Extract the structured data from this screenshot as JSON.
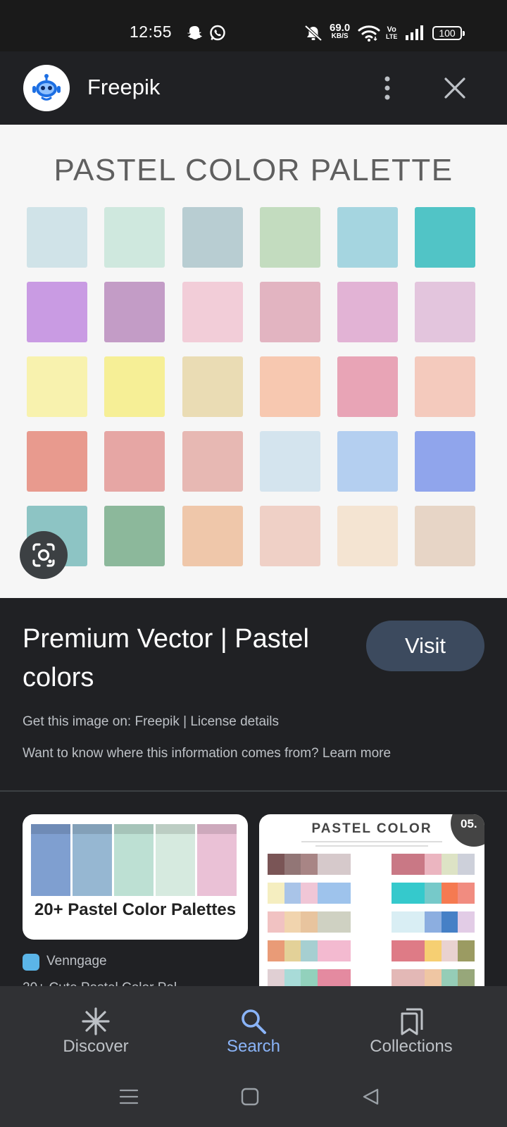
{
  "status_bar": {
    "time": "12:55",
    "net_speed_value": "69.0",
    "net_speed_unit": "KB/S",
    "volte_top": "Vo",
    "volte_bottom": "LTE",
    "battery": "100",
    "icons": [
      "snapchat-icon",
      "whatsapp-icon",
      "mute-icon",
      "wifi-icon",
      "signal-icon",
      "battery-icon"
    ]
  },
  "header": {
    "site_name": "Freepik",
    "icons": [
      "freepik-logo-icon",
      "more-vert-icon",
      "close-icon"
    ]
  },
  "image": {
    "title": "PASTEL COLOR PALETTE",
    "swatches": [
      [
        "#d0e3e8",
        "#cfe8de",
        "#b8cdd2",
        "#c3dcbf",
        "#a5d5e0",
        "#51c4c6"
      ],
      [
        "#c99be3",
        "#c39cc6",
        "#f2cdd8",
        "#e2b4c1",
        "#e2b3d5",
        "#e3c5dd"
      ],
      [
        "#f8f2ae",
        "#f6ef96",
        "#eadcb4",
        "#f7c8b0",
        "#e8a4b6",
        "#f4cabd"
      ],
      [
        "#e89a8e",
        "#e6a6a4",
        "#e7b8b3",
        "#d4e4ee",
        "#b4cff0",
        "#90a5ec"
      ],
      [
        "#8dc4c4",
        "#8cb89b",
        "#efc7aa",
        "#efd0c6",
        "#f4e4d2",
        "#e7d5c6"
      ]
    ],
    "lens_icon": "lens-camera-icon"
  },
  "result": {
    "title": "Premium Vector | Pastel colors",
    "visit_label": "Visit",
    "get_image_line": "Get this image on: Freepik | License details",
    "info_line": "Want to know where this information comes from? Learn more"
  },
  "related": {
    "left": {
      "caption": "20+ Pastel Color Palettes",
      "source": "Venngage",
      "text_cut": "20+ Cute Pastel Color Pal",
      "columns": [
        "#7f9fd0",
        "#96b7d2",
        "#bde0d3",
        "#d6eadf",
        "#eac1d6"
      ]
    },
    "right": {
      "title": "PASTEL COLOR",
      "badge": "05.",
      "left_strips": [
        [
          "#7a5556",
          "#927676",
          "#a88585",
          "#d6c9cb",
          "#d6c9cb"
        ],
        [
          "#f5eec0",
          "#a9c4e8",
          "#f0c6d6",
          "#9ec3ec",
          "#9ec3ec"
        ],
        [
          "#f1c2c2",
          "#f1d4ae",
          "#e8c49e",
          "#cfd1c2",
          "#cfd1c2"
        ],
        [
          "#e99b77",
          "#e3d198",
          "#a6cfd1",
          "#f3bad0",
          "#f3bad0"
        ],
        [
          "#e0cfd3",
          "#a8dbd8",
          "#92d1bc",
          "#e48aa0",
          "#e48aa0"
        ]
      ],
      "right_strips": [
        [
          "#c97885",
          "#c97885",
          "#ebb5c0",
          "#dde3c5",
          "#cdd0da"
        ],
        [
          "#35c9cc",
          "#35c9cc",
          "#76c9c9",
          "#f57a51",
          "#f18c80"
        ],
        [
          "#d9eef4",
          "#d9eef4",
          "#8caee0",
          "#4680c6",
          "#e2cce6"
        ],
        [
          "#de7b86",
          "#de7b86",
          "#f6cf72",
          "#e9d2d0",
          "#9b9b62"
        ],
        [
          "#e3b8b6",
          "#e3b8b6",
          "#efc6a3",
          "#95cdb7",
          "#97a77a"
        ]
      ]
    }
  },
  "bottom_nav": {
    "items": [
      {
        "label": "Discover",
        "icon": "discover-asterisk-icon"
      },
      {
        "label": "Search",
        "icon": "search-icon"
      },
      {
        "label": "Collections",
        "icon": "collections-icon"
      }
    ],
    "active": "Search",
    "active_color": "#8ab4f8",
    "system_icons": [
      "recents-menu-icon",
      "home-square-icon",
      "back-triangle-icon"
    ]
  }
}
